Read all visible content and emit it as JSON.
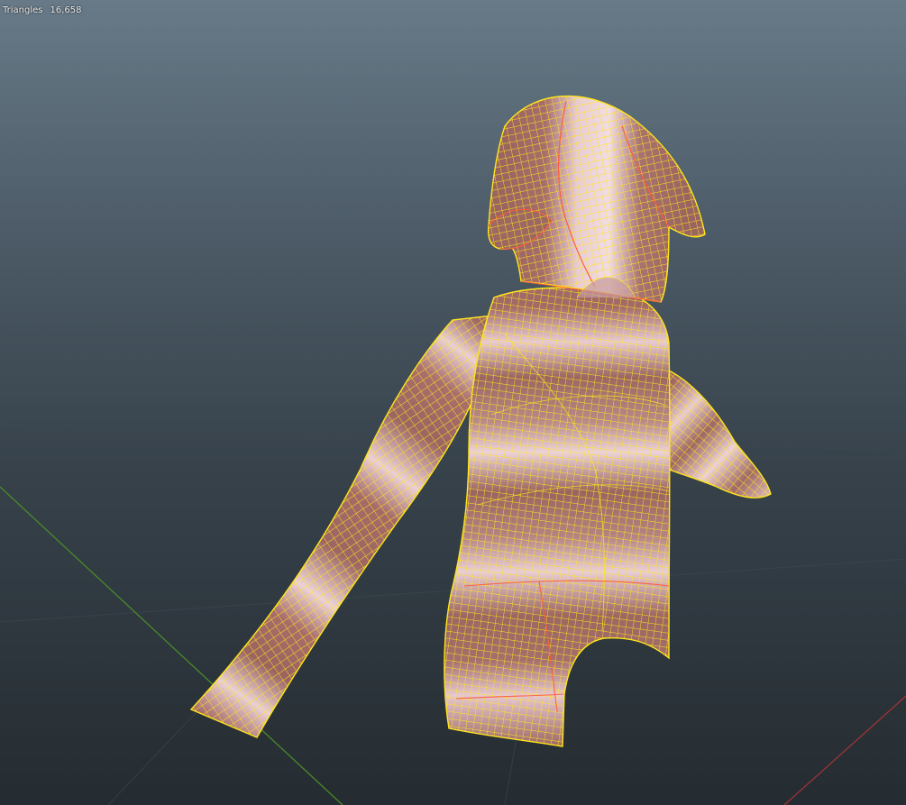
{
  "viewport": {
    "overlay": {
      "triangles_label": "Triangles",
      "triangles_value": "16,658",
      "cut_line_text": "·· · · · · · ··"
    },
    "axes": {
      "y_axis_color": "#4a8a2a",
      "x_axis_color": "#9a3434"
    },
    "mesh": {
      "object": "hoodie",
      "wire_color": "#ffe61a",
      "seam_color": "#ff4a3a",
      "fabric_dark": "#9a6460",
      "fabric_light": "#e9c9d2"
    }
  }
}
